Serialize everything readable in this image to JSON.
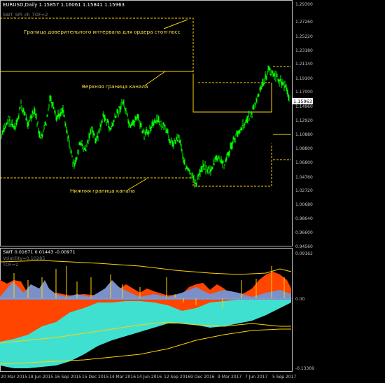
{
  "colors": {
    "background": "#000000",
    "axis": "#c0c0c0",
    "price_candles": "#00ff00",
    "guide_lines": "#ffd400",
    "annotation_text": "#ffe24a",
    "current_price_box": "#ffffff",
    "indicator_orange": "#ff4500",
    "indicator_turquoise": "#40e0d0",
    "indicator_slate": "#7b8fc8",
    "indicator_lines": "#ffd400"
  },
  "price_panel": {
    "symbol_info": "EURUSD,Daily  1.15857 1.16061 1.15841 1.15963",
    "indicator_tag": "SWT_SPI_ch_TOF=2",
    "current_price": "1.15963",
    "y_ticks": [
      "1.29300",
      "1.27260",
      "1.25220",
      "1.23180",
      "1.21140",
      "1.19100",
      "1.17000",
      "1.14960",
      "1.12920",
      "1.10880",
      "1.08800",
      "1.06800",
      "1.04760",
      "1.02720",
      "1.00680",
      "0.98640",
      "0.96600",
      "0.94560"
    ],
    "annotations": {
      "stop_loss_interval": "Граница доверительного интервала для ордера стоп-лосс",
      "upper_channel": "Верхняя граница канала",
      "lower_channel": "Нижняя граница канала"
    }
  },
  "indicator_panel": {
    "header": "SWT  0.01671  0.01443  -0.00971",
    "volatility": "Volatility=0.10285",
    "tof": "TOF=2",
    "y_ticks": [
      "0.09162",
      "0.00",
      "-0.13369"
    ]
  },
  "x_axis": {
    "labels": [
      "20 Mar 2015",
      "18 Jun 2015",
      "16 Sep 2015",
      "15 Dec 2015",
      "14 Mar 2016",
      "14 Jun 2016",
      "12 Sep 2016",
      "9 Dec 2016",
      "9 Mar 2017",
      "7 Jun 2017",
      "5 Sep 2017"
    ]
  }
}
